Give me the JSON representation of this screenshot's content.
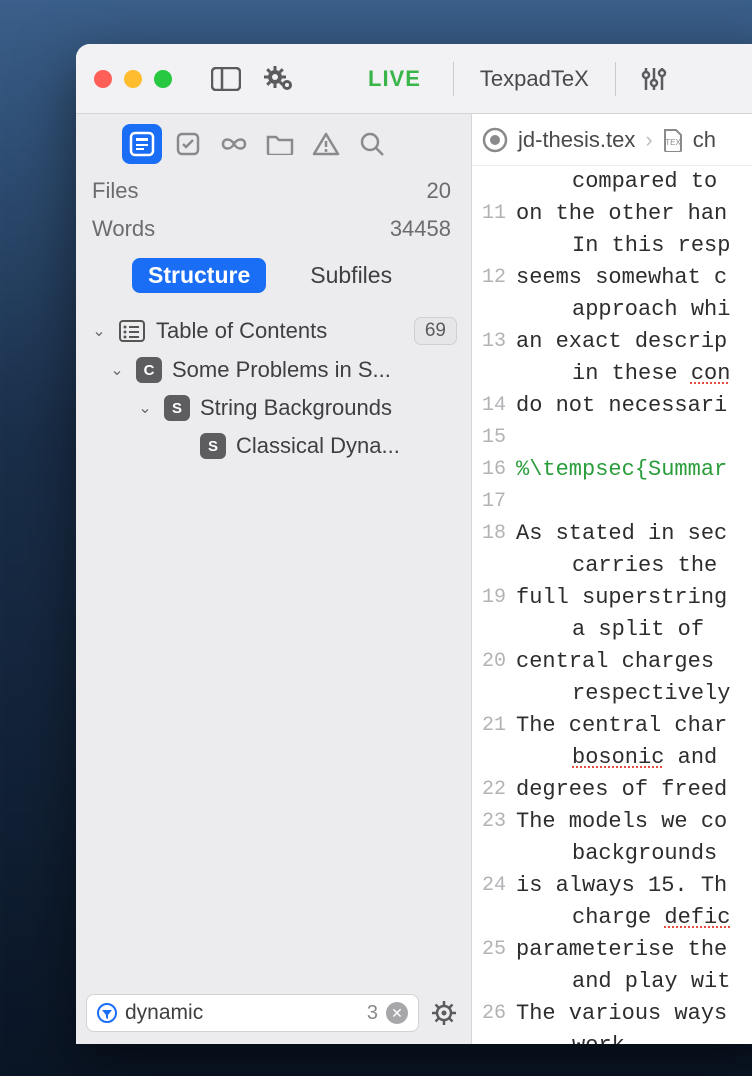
{
  "titlebar": {
    "live": "LIVE",
    "engine": "TexpadTeX"
  },
  "sidebar": {
    "stats": {
      "files_label": "Files",
      "files_count": "20",
      "words_label": "Words",
      "words_count": "34458"
    },
    "tabs": {
      "structure": "Structure",
      "subfiles": "Subfiles"
    },
    "toc": {
      "label": "Table of Contents",
      "count": "69",
      "items": [
        {
          "badge": "C",
          "label": "Some Problems in S..."
        },
        {
          "badge": "S",
          "label": "String Backgrounds"
        },
        {
          "badge": "S",
          "label": "Classical Dyna..."
        }
      ]
    },
    "filter": {
      "query": "dynamic",
      "count": "3"
    }
  },
  "editor": {
    "crumb_file": "jd-thesis.tex",
    "crumb_child": "ch",
    "lines": [
      {
        "n": "",
        "t": "compared to",
        "cont": true
      },
      {
        "n": "11",
        "t": "on the other han"
      },
      {
        "n": "",
        "t": "In this resp",
        "cont": true
      },
      {
        "n": "12",
        "t": "seems somewhat c"
      },
      {
        "n": "",
        "t": "approach whi",
        "cont": true
      },
      {
        "n": "13",
        "t": "an exact descrip"
      },
      {
        "n": "",
        "t": "in these ",
        "cont": true,
        "err": "con"
      },
      {
        "n": "14",
        "t": "do not necessari"
      },
      {
        "n": "15",
        "t": ""
      },
      {
        "n": "16",
        "t": "%\\tempsec{Summar",
        "cls": "cmnt"
      },
      {
        "n": "17",
        "t": ""
      },
      {
        "n": "18",
        "t": "As stated in sec"
      },
      {
        "n": "",
        "t": "carries the",
        "cont": true
      },
      {
        "n": "19",
        "t": "full superstring"
      },
      {
        "n": "",
        "t": "a split of ",
        "cont": true
      },
      {
        "n": "20",
        "t": "central charges"
      },
      {
        "n": "",
        "t": "respectively",
        "cont": true
      },
      {
        "n": "21",
        "t": "The central char"
      },
      {
        "n": "",
        "t": "",
        "cont": true,
        "err": "bosonic",
        "tail": " and"
      },
      {
        "n": "22",
        "t": "degrees of freed"
      },
      {
        "n": "23",
        "t": "The models we co"
      },
      {
        "n": "",
        "t": "backgrounds",
        "cont": true
      },
      {
        "n": "24",
        "t": "is always 15. Th"
      },
      {
        "n": "",
        "t": "charge ",
        "cont": true,
        "err": "defic"
      },
      {
        "n": "25",
        "t": "parameterise the"
      },
      {
        "n": "",
        "t": "and play wit",
        "cont": true
      },
      {
        "n": "26",
        "t": "The various ways"
      },
      {
        "n": "",
        "t": "work.",
        "cont": true
      }
    ]
  }
}
